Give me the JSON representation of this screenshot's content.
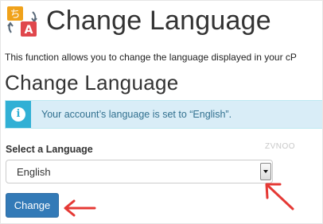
{
  "header": {
    "title": "Change Language",
    "icon_glyphs": {
      "source": "ち",
      "target": "A"
    }
  },
  "description": "This function allows you to change the language displayed in your cP",
  "section": {
    "title": "Change Language"
  },
  "alert": {
    "icon": "info-icon",
    "icon_glyph": "i",
    "text": "Your account’s language is set to “English”."
  },
  "watermark": "ZVNOO",
  "language_select": {
    "label": "Select a Language",
    "selected_value": "English"
  },
  "actions": {
    "change_label": "Change"
  },
  "colors": {
    "primary_button": "#337ab7",
    "alert_background": "#d9edf7",
    "alert_icon_strip": "#31b0d5",
    "alert_text": "#31708f",
    "annotation_arrow": "#e53935",
    "icon_orange": "#f0a21a",
    "icon_red": "#e0474c"
  }
}
